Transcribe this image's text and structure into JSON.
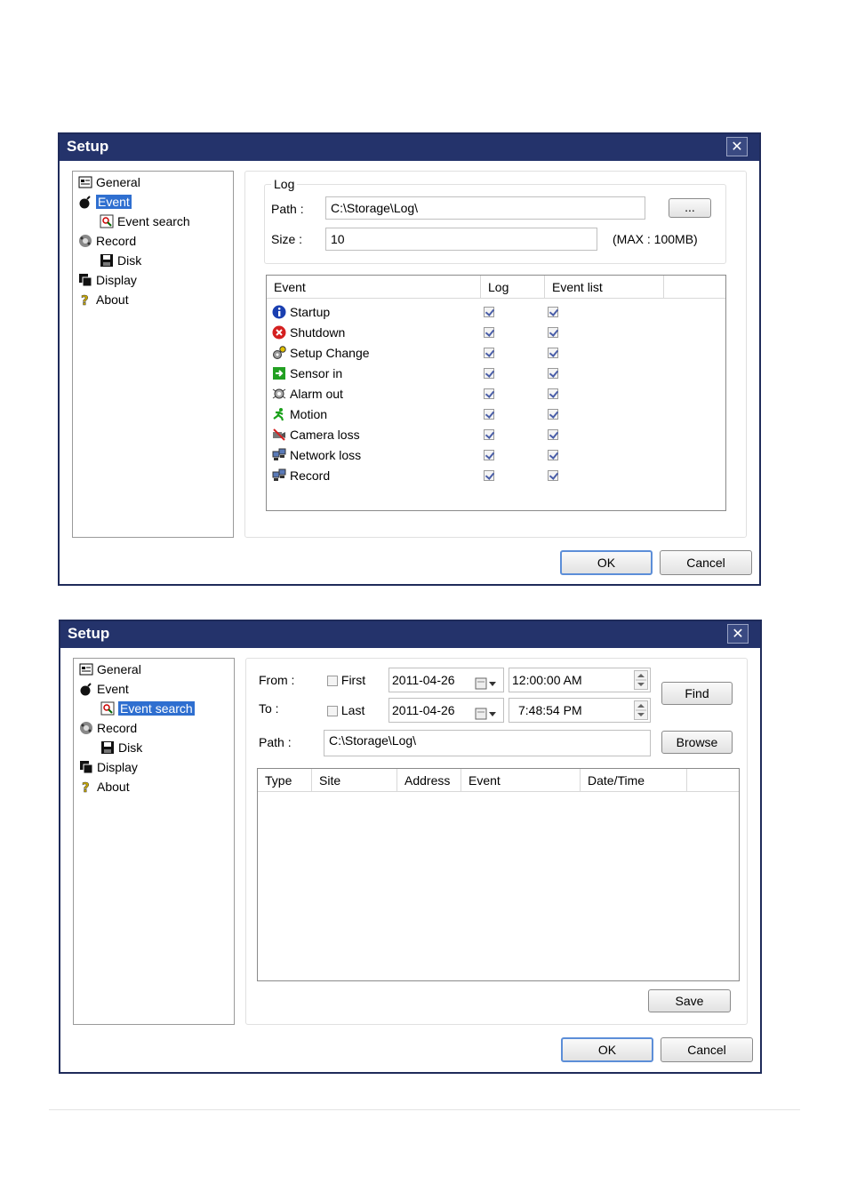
{
  "window1": {
    "title": "Setup",
    "close": "✕",
    "tree": [
      "General",
      "Event",
      "Event search",
      "Record",
      "Disk",
      "Display",
      "About"
    ],
    "log_group": "Log",
    "path_label": "Path :",
    "path_value": "C:\\Storage\\Log\\",
    "browse_small": "...",
    "size_label": "Size :",
    "size_value": "10",
    "max_note": "(MAX : 100MB)",
    "columns": [
      "Event",
      "Log",
      "Event list"
    ],
    "events": [
      {
        "name": "Startup",
        "log": true,
        "list": true,
        "icon": "info-icon"
      },
      {
        "name": "Shutdown",
        "log": true,
        "list": true,
        "icon": "shutdown-icon"
      },
      {
        "name": "Setup Change",
        "log": true,
        "list": true,
        "icon": "gears-icon"
      },
      {
        "name": "Sensor in",
        "log": true,
        "list": true,
        "icon": "sensor-icon"
      },
      {
        "name": "Alarm out",
        "log": true,
        "list": true,
        "icon": "alarm-icon"
      },
      {
        "name": "Motion",
        "log": true,
        "list": true,
        "icon": "runner-icon"
      },
      {
        "name": "Camera loss",
        "log": true,
        "list": true,
        "icon": "camera-loss-icon"
      },
      {
        "name": "Network loss",
        "log": true,
        "list": true,
        "icon": "network-icon"
      },
      {
        "name": "Record",
        "log": true,
        "list": true,
        "icon": "record-icon"
      }
    ],
    "ok": "OK",
    "cancel": "Cancel"
  },
  "window2": {
    "title": "Setup",
    "close": "✕",
    "tree": [
      "General",
      "Event",
      "Event search",
      "Record",
      "Disk",
      "Display",
      "About"
    ],
    "from_label": "From :",
    "to_label": "To :",
    "first_label": "First",
    "last_label": "Last",
    "from_date": "2011-04-26",
    "to_date": "2011-04-26",
    "from_time": "12:00:00 AM",
    "to_time": "7:48:54 PM",
    "find": "Find",
    "path_label": "Path :",
    "path_value": "C:\\Storage\\Log\\",
    "browse": "Browse",
    "columns": [
      "Type",
      "Site",
      "Address",
      "Event",
      "Date/Time"
    ],
    "save": "Save",
    "ok": "OK",
    "cancel": "Cancel"
  }
}
